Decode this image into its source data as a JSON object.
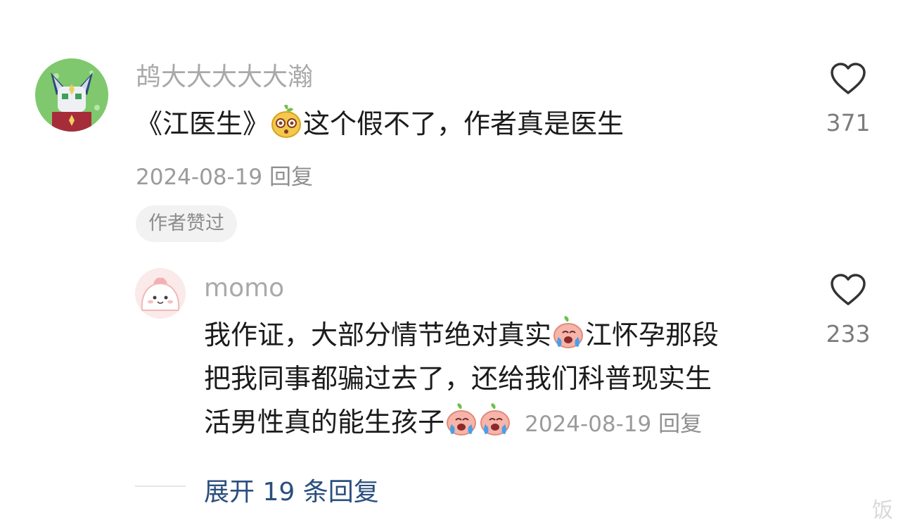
{
  "comment": {
    "username": "鸪大大大大大瀚",
    "text_before": "《江医生》",
    "emoji_icon": "wow-face-emoji",
    "text_after": "这个假不了，作者真是医生",
    "date": "2024-08-19",
    "reply_label": "回复",
    "badge": "作者赞过",
    "likes": "371"
  },
  "reply": {
    "username": "momo",
    "line1_before": "我作证，大部分情节绝对真实",
    "line1_after": "江怀孕那段",
    "line2": "把我同事都骗过去了，还给我们科普现实生",
    "line3": "活男性真的能生孩子",
    "emoji_icon": "crying-face-emoji",
    "date": "2024-08-19",
    "reply_label": "回复",
    "likes": "233"
  },
  "expand_replies_label": "展开 19 条回复",
  "watermark": "饭"
}
